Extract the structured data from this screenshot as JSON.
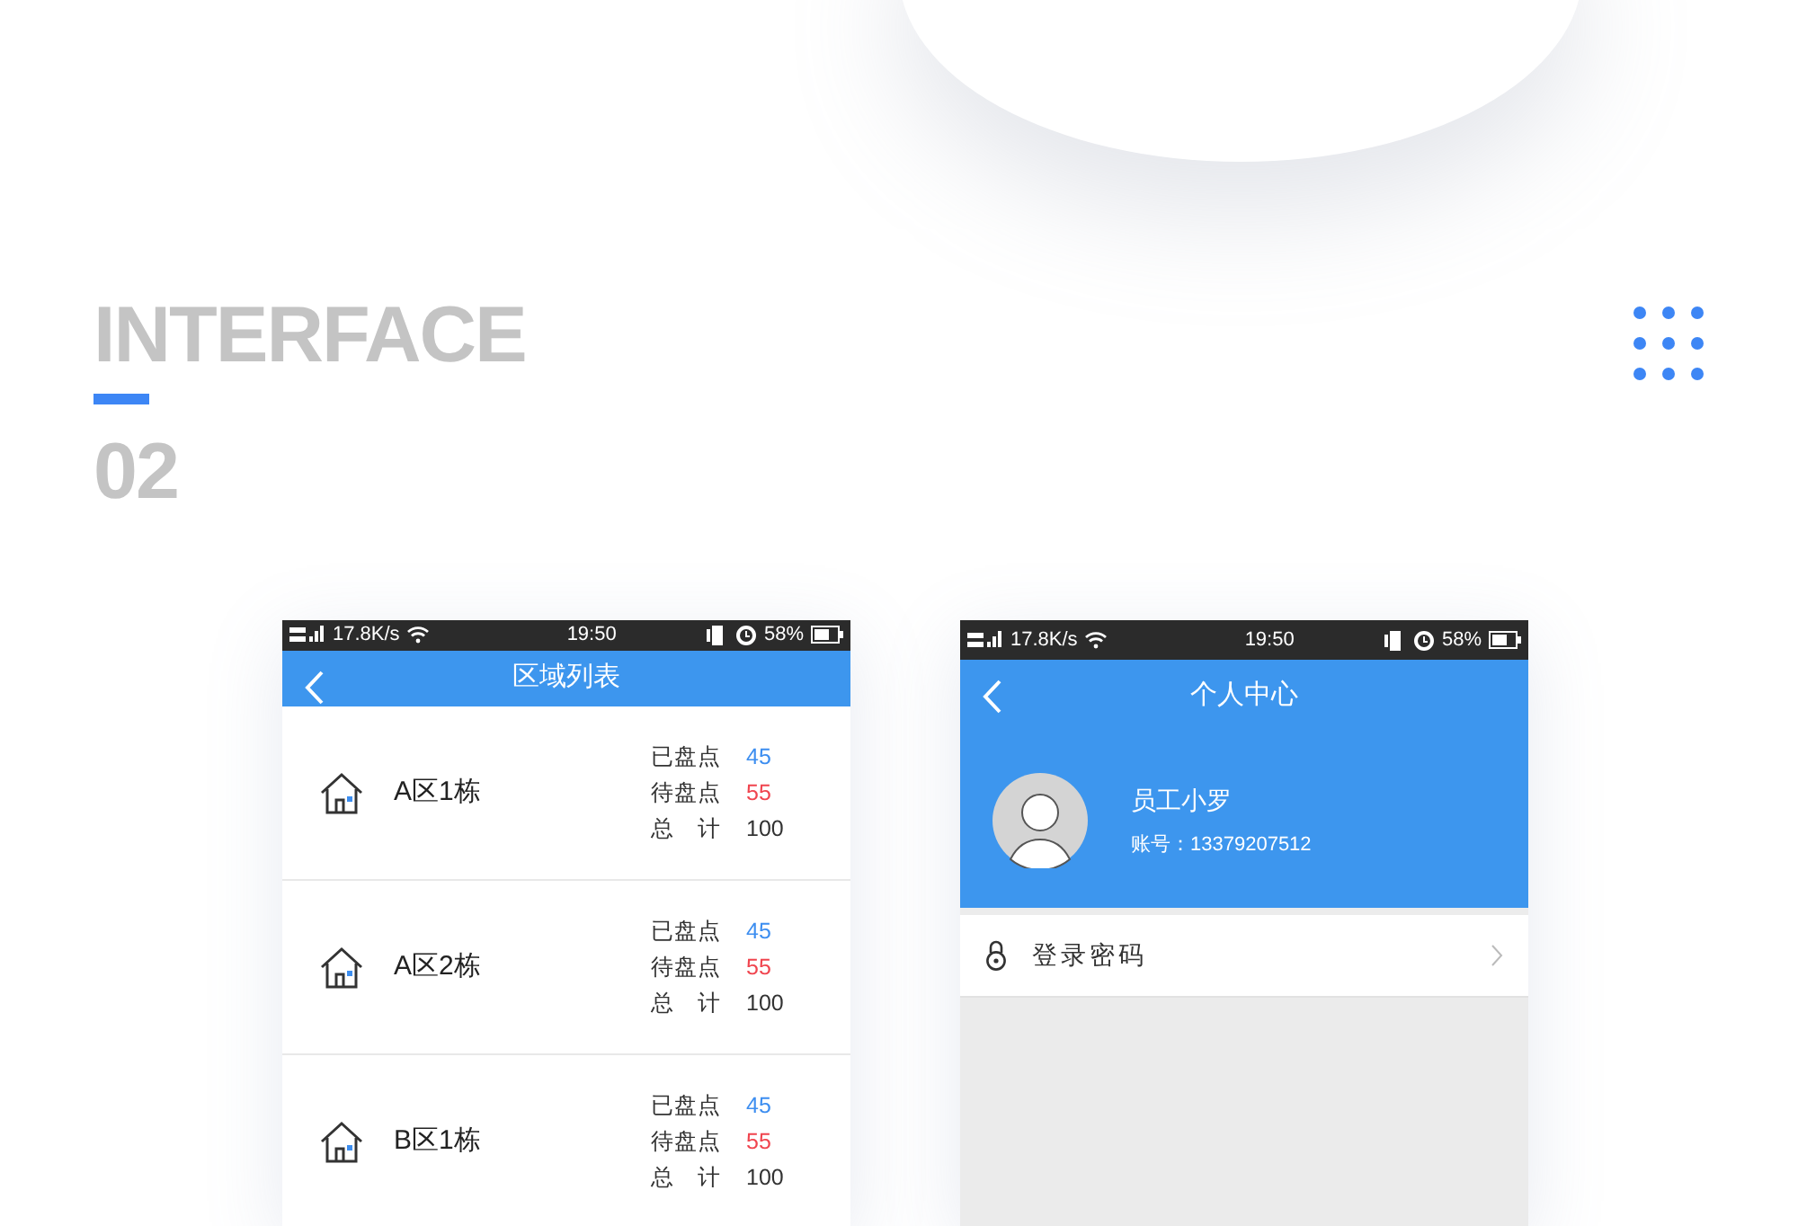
{
  "heading": {
    "title": "INTERFACE",
    "number": "02"
  },
  "phones": [
    {
      "kind": "list",
      "status": {
        "speed": "17.8K/s",
        "time": "19:50",
        "battery": "58%"
      },
      "title": "区域列表",
      "areas": [
        {
          "name": "A区1栋",
          "stats": [
            {
              "kind": "done",
              "label": "已盘点",
              "value": "45"
            },
            {
              "kind": "pending",
              "label": "待盘点",
              "value": "55"
            },
            {
              "kind": "total",
              "label": "总　计",
              "value": "100"
            }
          ]
        },
        {
          "name": "A区2栋",
          "stats": [
            {
              "kind": "done",
              "label": "已盘点",
              "value": "45"
            },
            {
              "kind": "pending",
              "label": "待盘点",
              "value": "55"
            },
            {
              "kind": "total",
              "label": "总　计",
              "value": "100"
            }
          ]
        },
        {
          "name": "B区1栋",
          "stats": [
            {
              "kind": "done",
              "label": "已盘点",
              "value": "45"
            },
            {
              "kind": "pending",
              "label": "待盘点",
              "value": "55"
            },
            {
              "kind": "total",
              "label": "总　计",
              "value": "100"
            }
          ]
        }
      ]
    },
    {
      "kind": "profile",
      "status": {
        "speed": "17.8K/s",
        "time": "19:50",
        "battery": "58%"
      },
      "title": "个人中心",
      "user": {
        "name": "员工小罗",
        "account": "账号：13379207512"
      },
      "menu": [
        {
          "label": "登录密码"
        }
      ]
    }
  ]
}
